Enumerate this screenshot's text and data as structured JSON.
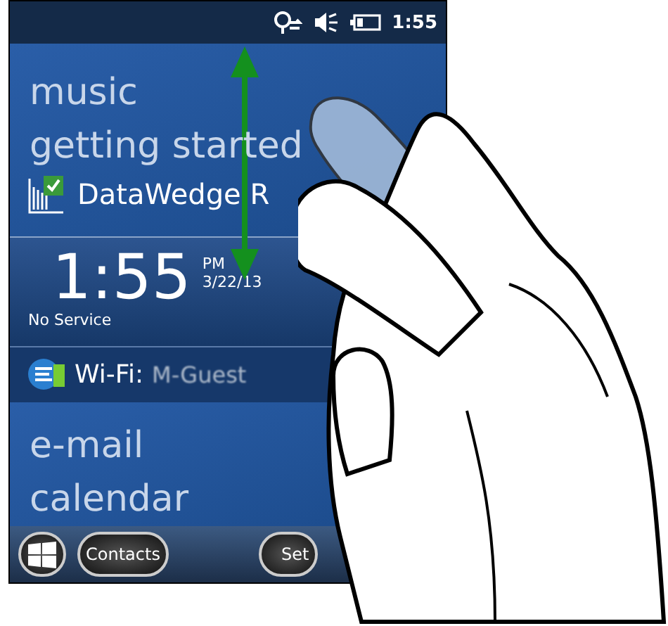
{
  "status_bar": {
    "time": "1:55"
  },
  "menu_top": [
    "music",
    "getting started"
  ],
  "datawedge": {
    "label": "DataWedge R"
  },
  "clock": {
    "time": "1:55",
    "ampm": "PM",
    "date": "3/22/13",
    "carrier": "No Service"
  },
  "wifi": {
    "label": "Wi-Fi:",
    "network": "M-Guest"
  },
  "menu_bottom": [
    "e-mail",
    "calendar"
  ],
  "softkeys": [
    {
      "kind": "start"
    },
    {
      "kind": "text",
      "label": "Contacts"
    },
    {
      "kind": "text",
      "label": "Set"
    }
  ]
}
